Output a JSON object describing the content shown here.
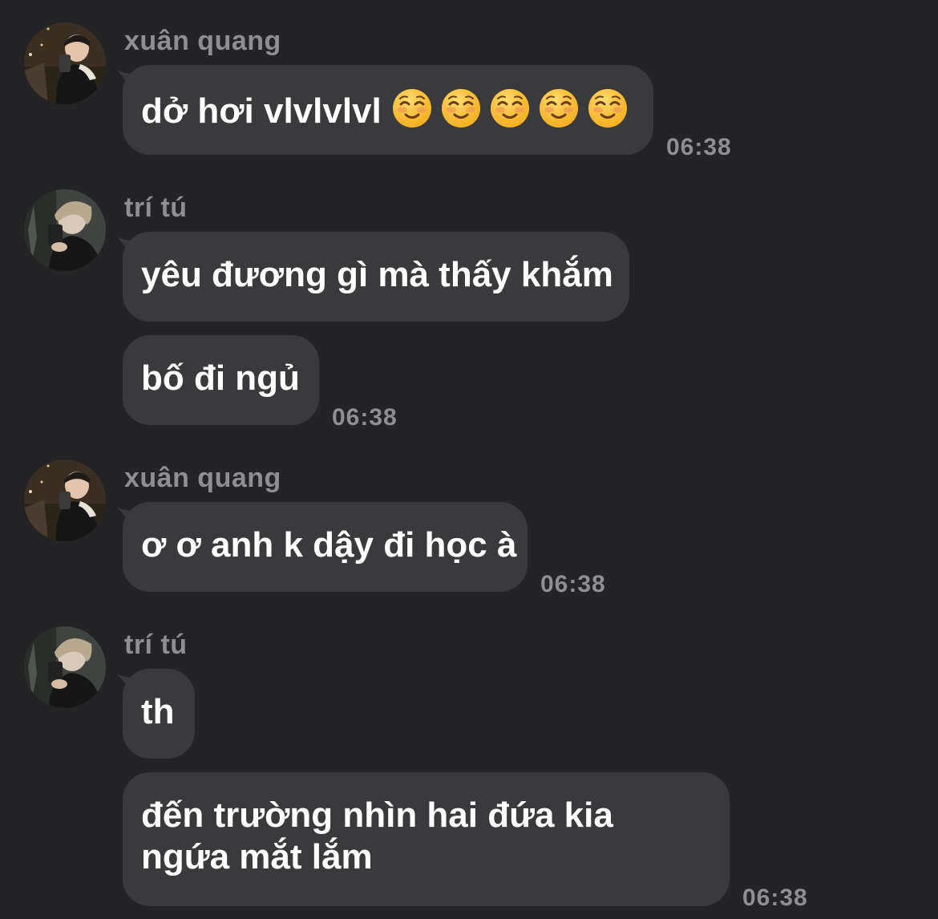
{
  "conversation": {
    "groups": [
      {
        "sender": "xuân quang",
        "avatar": "xuan-quang-avatar",
        "messages": [
          {
            "text": "dở hơi vlvlvlvl",
            "emoji": "smiling-face-emoji",
            "emoji_count": 5
          }
        ],
        "time": "06:38"
      },
      {
        "sender": "trí tú",
        "avatar": "tri-tu-avatar",
        "messages": [
          {
            "text": "yêu đương gì mà thấy khắm"
          },
          {
            "text": "bố đi ngủ"
          }
        ],
        "time": "06:38"
      },
      {
        "sender": "xuân quang",
        "avatar": "xuan-quang-avatar",
        "messages": [
          {
            "text": "ơ ơ anh k dậy đi học à"
          }
        ],
        "time": "06:38"
      },
      {
        "sender": "trí tú",
        "avatar": "tri-tu-avatar",
        "messages": [
          {
            "text": "th"
          },
          {
            "text": "đến trường nhìn hai đứa kia ngứa mắt lắm"
          }
        ],
        "time": "06:38"
      }
    ]
  },
  "colors": {
    "background": "#242426",
    "bubble": "#3a3a3c",
    "secondary_text": "#8e8e93",
    "text": "#ffffff"
  }
}
